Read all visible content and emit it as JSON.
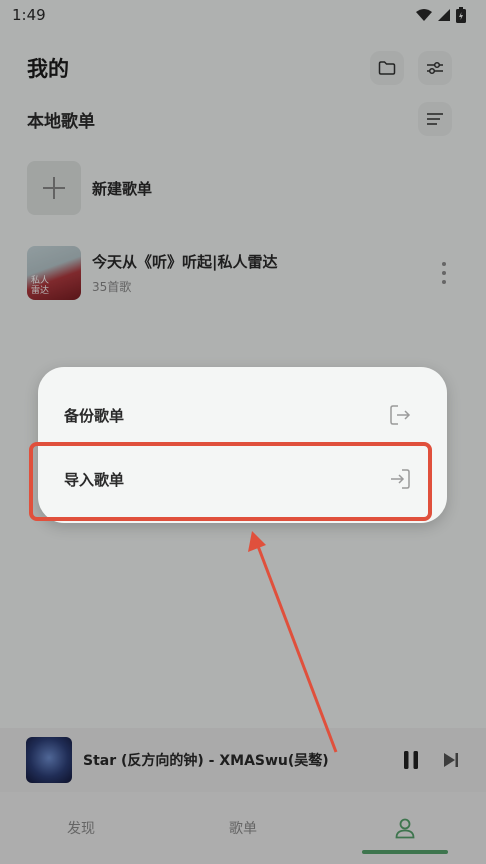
{
  "status": {
    "time": "1:49"
  },
  "header": {
    "title": "我的"
  },
  "local": {
    "title": "本地歌单"
  },
  "new_playlist": {
    "label": "新建歌单"
  },
  "playlists": [
    {
      "title": "今天从《听》听起|私人雷达",
      "count": "35首歌",
      "cover_text": "私人\n雷达"
    }
  ],
  "menu": {
    "items": [
      {
        "label": "备份歌单",
        "icon": "export-icon"
      },
      {
        "label": "导入歌单",
        "icon": "import-icon"
      }
    ]
  },
  "player": {
    "title": "Star (反方向的钟) - XMASwu(吴骜)"
  },
  "tabs": [
    {
      "label": "发现"
    },
    {
      "label": "歌单"
    },
    {
      "label": "",
      "icon": "person-icon",
      "active": true
    }
  ],
  "colors": {
    "highlight": "#e0503c",
    "accent": "#57a36c"
  }
}
